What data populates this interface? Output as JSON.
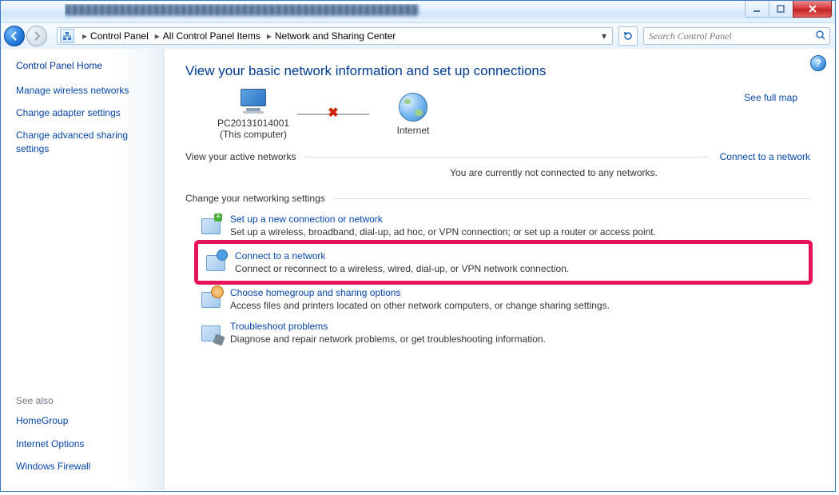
{
  "breadcrumbs": [
    "Control Panel",
    "All Control Panel Items",
    "Network and Sharing Center"
  ],
  "search": {
    "placeholder": "Search Control Panel"
  },
  "sidebar": {
    "home": "Control Panel Home",
    "links": [
      "Manage wireless networks",
      "Change adapter settings",
      "Change advanced sharing settings"
    ],
    "seealso_label": "See also",
    "seealso": [
      "HomeGroup",
      "Internet Options",
      "Windows Firewall"
    ]
  },
  "content": {
    "title": "View your basic network information and set up connections",
    "see_full_map": "See full map",
    "node_pc_name": "PC20131014001",
    "node_pc_sub": "(This computer)",
    "node_internet": "Internet",
    "active_label": "View your active networks",
    "connect_link": "Connect to a network",
    "not_connected": "You are currently not connected to any networks.",
    "change_label": "Change your networking settings",
    "options": [
      {
        "title": "Set up a new connection or network",
        "desc": "Set up a wireless, broadband, dial-up, ad hoc, or VPN connection; or set up a router or access point."
      },
      {
        "title": "Connect to a network",
        "desc": "Connect or reconnect to a wireless, wired, dial-up, or VPN network connection."
      },
      {
        "title": "Choose homegroup and sharing options",
        "desc": "Access files and printers located on other network computers, or change sharing settings."
      },
      {
        "title": "Troubleshoot problems",
        "desc": "Diagnose and repair network problems, or get troubleshooting information."
      }
    ]
  }
}
